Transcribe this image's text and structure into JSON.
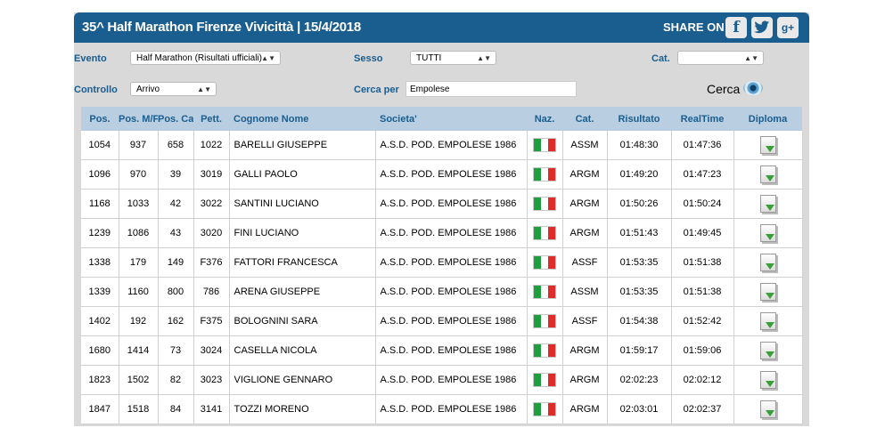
{
  "header": {
    "title": "35^ Half Marathon Firenze Vivicittà  |  15/4/2018",
    "share_label": "SHARE ON",
    "social": [
      {
        "name": "facebook",
        "glyph": "f"
      },
      {
        "name": "twitter",
        "glyph": "🐦"
      },
      {
        "name": "google-plus",
        "glyph": "g+"
      }
    ]
  },
  "filters": {
    "evento": {
      "label": "Evento",
      "value": "Half Marathon (Risultati ufficiali)"
    },
    "sesso": {
      "label": "Sesso",
      "value": "TUTTI"
    },
    "cat": {
      "label": "Cat.",
      "value": ""
    },
    "controllo": {
      "label": "Controllo",
      "value": "Arrivo"
    },
    "cerca_per": {
      "label": "Cerca per",
      "value": "Empolese"
    },
    "search_button": "Cerca"
  },
  "table": {
    "columns": [
      "Pos.",
      "Pos. M/F",
      "Pos. Cat.",
      "Pett.",
      "Cognome Nome",
      "Societa'",
      "Naz.",
      "Cat.",
      "Risultato",
      "RealTime",
      "Diploma"
    ],
    "rows": [
      [
        "1054",
        "937",
        "658",
        "1022",
        "BARELLI GIUSEPPE",
        "A.S.D. POD. EMPOLESE 1986",
        "ITA",
        "ASSM",
        "01:48:30",
        "01:47:36"
      ],
      [
        "1096",
        "970",
        "39",
        "3019",
        "GALLI PAOLO",
        "A.S.D. POD. EMPOLESE 1986",
        "ITA",
        "ARGM",
        "01:49:20",
        "01:47:23"
      ],
      [
        "1168",
        "1033",
        "42",
        "3022",
        "SANTINI LUCIANO",
        "A.S.D. POD. EMPOLESE 1986",
        "ITA",
        "ARGM",
        "01:50:26",
        "01:50:24"
      ],
      [
        "1239",
        "1086",
        "43",
        "3020",
        "FINI LUCIANO",
        "A.S.D. POD. EMPOLESE 1986",
        "ITA",
        "ARGM",
        "01:51:43",
        "01:49:45"
      ],
      [
        "1338",
        "179",
        "149",
        "F376",
        "FATTORI FRANCESCA",
        "A.S.D. POD. EMPOLESE 1986",
        "ITA",
        "ASSF",
        "01:53:35",
        "01:51:38"
      ],
      [
        "1339",
        "1160",
        "800",
        "786",
        "ARENA GIUSEPPE",
        "A.S.D. POD. EMPOLESE 1986",
        "ITA",
        "ASSM",
        "01:53:35",
        "01:51:38"
      ],
      [
        "1402",
        "192",
        "162",
        "F375",
        "BOLOGNINI SARA",
        "A.S.D. POD. EMPOLESE 1986",
        "ITA",
        "ASSF",
        "01:54:38",
        "01:52:42"
      ],
      [
        "1680",
        "1414",
        "73",
        "3024",
        "CASELLA NICOLA",
        "A.S.D. POD. EMPOLESE 1986",
        "ITA",
        "ARGM",
        "01:59:17",
        "01:59:06"
      ],
      [
        "1823",
        "1502",
        "82",
        "3023",
        "VIGLIONE GENNARO",
        "A.S.D. POD. EMPOLESE 1986",
        "ITA",
        "ARGM",
        "02:02:23",
        "02:02:12"
      ],
      [
        "1847",
        "1518",
        "84",
        "3141",
        "TOZZI MORENO",
        "A.S.D. POD. EMPOLESE 1986",
        "ITA",
        "ARGM",
        "02:03:01",
        "02:02:37"
      ]
    ]
  },
  "colors": {
    "brand": "#1a5d8f",
    "header_row": "#b9cfe1",
    "panel": "#d9d9d9"
  }
}
